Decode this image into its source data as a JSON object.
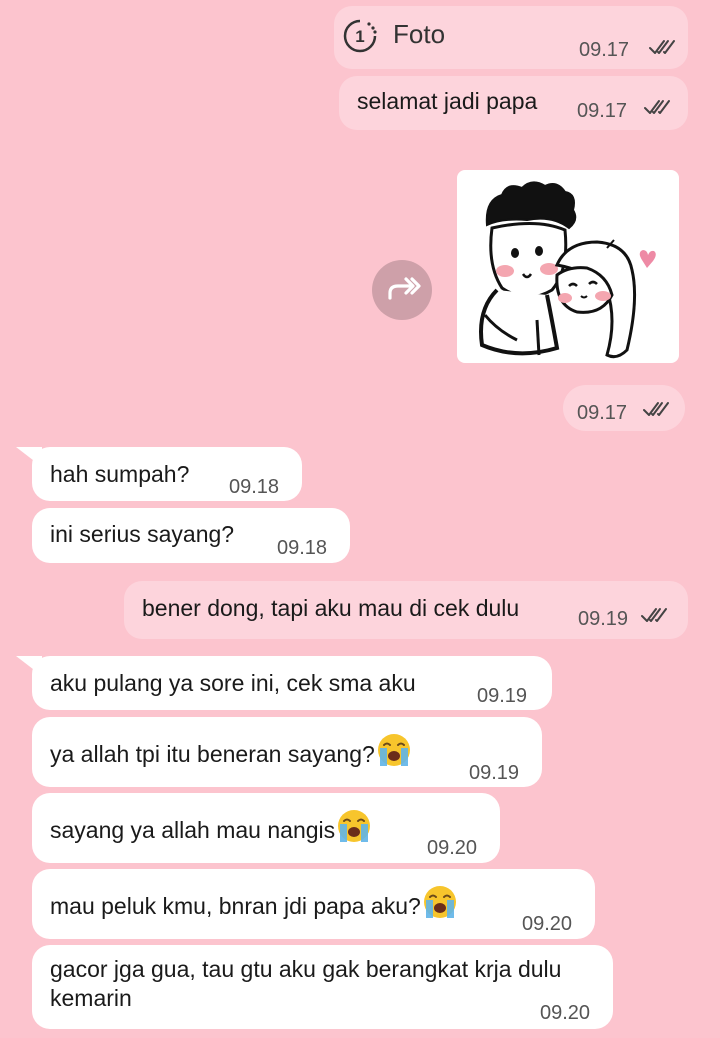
{
  "colors": {
    "background": "#fcc4ce",
    "outgoing_bubble": "#fdd4dc",
    "incoming_bubble": "#ffffff",
    "time_text": "#555555"
  },
  "messages": [
    {
      "direction": "out",
      "type": "view-once-photo",
      "text": "Foto",
      "view_once_digit": "1",
      "time": "09.17",
      "status": "read"
    },
    {
      "direction": "out",
      "type": "text",
      "text": "selamat jadi papa",
      "time": "09.17",
      "status": "read"
    },
    {
      "direction": "out",
      "type": "forwarded-sticker",
      "image": "couple-doodle-sticker",
      "time": "09.17",
      "status": "read"
    },
    {
      "direction": "in",
      "type": "text",
      "text": "hah sumpah?",
      "time": "09.18"
    },
    {
      "direction": "in",
      "type": "text",
      "text": "ini serius sayang?",
      "time": "09.18"
    },
    {
      "direction": "out",
      "type": "text",
      "text": "bener dong, tapi aku mau di cek dulu",
      "time": "09.19",
      "status": "read"
    },
    {
      "direction": "in",
      "type": "text",
      "text": "aku pulang ya sore ini, cek sma aku",
      "time": "09.19"
    },
    {
      "direction": "in",
      "type": "text",
      "text": "ya allah tpi itu beneran sayang?",
      "emoji": "loudly-crying-face",
      "time": "09.19"
    },
    {
      "direction": "in",
      "type": "text",
      "text": "sayang ya allah mau nangis",
      "emoji": "loudly-crying-face",
      "time": "09.20"
    },
    {
      "direction": "in",
      "type": "text",
      "text": "mau peluk kmu, bnran jdi papa aku?",
      "emoji": "loudly-crying-face",
      "time": "09.20"
    },
    {
      "direction": "in",
      "type": "text",
      "text": "gacor jga gua, tau gtu aku gak berangkat krja dulu kemarin",
      "time": "09.20"
    }
  ],
  "icons": {
    "view_once": "view-once-icon",
    "read_receipt": "double-check-icon",
    "forward": "forward-icon",
    "emoji": "loudly-crying-face-emoji"
  }
}
